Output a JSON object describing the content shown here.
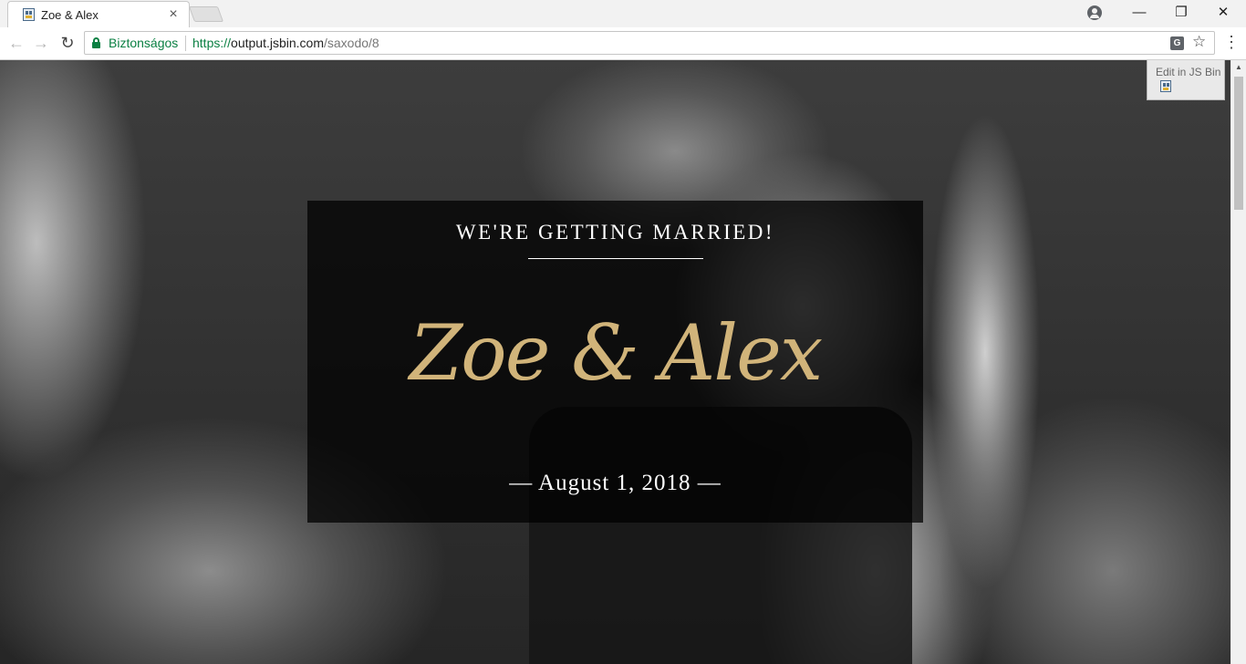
{
  "browser": {
    "tab_title": "Zoe & Alex",
    "tab_close": "×",
    "secure_label": "Biztonságos",
    "url_scheme": "https://",
    "url_host": "output.jsbin.com",
    "url_path": "/saxodo/8",
    "translate_glyph": "G",
    "star_glyph": "☆",
    "menu_glyph": "⋮",
    "back_glyph": "←",
    "forward_glyph": "→",
    "reload_glyph": "↻",
    "minimize_glyph": "—",
    "restore_glyph": "❐",
    "close_glyph": "✕",
    "scroll_up_glyph": "▲"
  },
  "page": {
    "announcement": "WE'RE GETTING MARRIED!",
    "names": "Zoe & Alex",
    "date": "— August 1, 2018 —",
    "jsbin_badge": "Edit in JS Bin"
  },
  "colors": {
    "accent_gold": "#d1b47a",
    "secure_green": "#0b8043",
    "overlay": "rgba(0,0,0,0.74)"
  },
  "icons": {
    "favicon": "jsbin-favicon-icon",
    "profile": "profile-icon",
    "lock": "lock-icon",
    "translate": "translate-icon",
    "bookmark": "star-icon"
  }
}
